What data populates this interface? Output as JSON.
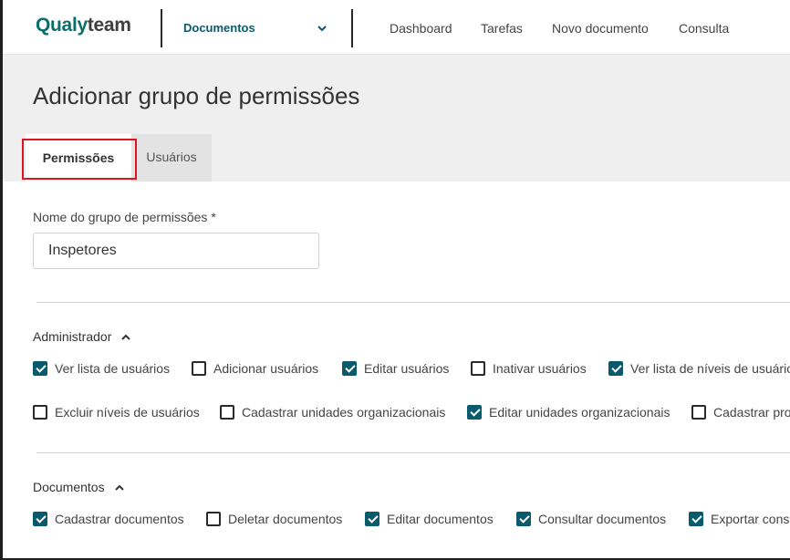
{
  "header": {
    "logo_primary": "Qualy",
    "logo_secondary": "team",
    "module": "Documentos",
    "nav": [
      "Dashboard",
      "Tarefas",
      "Novo documento",
      "Consulta"
    ]
  },
  "page": {
    "title": "Adicionar grupo de permissões",
    "tabs": [
      {
        "label": "Permissões",
        "active": true
      },
      {
        "label": "Usuários",
        "active": false
      }
    ]
  },
  "form": {
    "group_name_label": "Nome do grupo de permissões *",
    "group_name_value": "Inspetores"
  },
  "sections": [
    {
      "title": "Administrador",
      "items": [
        {
          "label": "Ver lista de usuários",
          "checked": true
        },
        {
          "label": "Adicionar usuários",
          "checked": false
        },
        {
          "label": "Editar usuários",
          "checked": true
        },
        {
          "label": "Inativar usuários",
          "checked": false
        },
        {
          "label": "Ver lista de níveis de usuário",
          "checked": true
        },
        {
          "label": "Excluir níveis de usuários",
          "checked": false
        },
        {
          "label": "Cadastrar unidades organizacionais",
          "checked": false
        },
        {
          "label": "Editar unidades organizacionais",
          "checked": true
        },
        {
          "label": "Cadastrar pro",
          "checked": false
        }
      ]
    },
    {
      "title": "Documentos",
      "items": [
        {
          "label": "Cadastrar documentos",
          "checked": true
        },
        {
          "label": "Deletar documentos",
          "checked": false
        },
        {
          "label": "Editar documentos",
          "checked": true
        },
        {
          "label": "Consultar documentos",
          "checked": true
        },
        {
          "label": "Exportar cons",
          "checked": true
        }
      ]
    }
  ],
  "colors": {
    "brand": "#0a6e6a",
    "checkbox_checked": "#0a5a6e",
    "highlight": "#e0141e"
  }
}
